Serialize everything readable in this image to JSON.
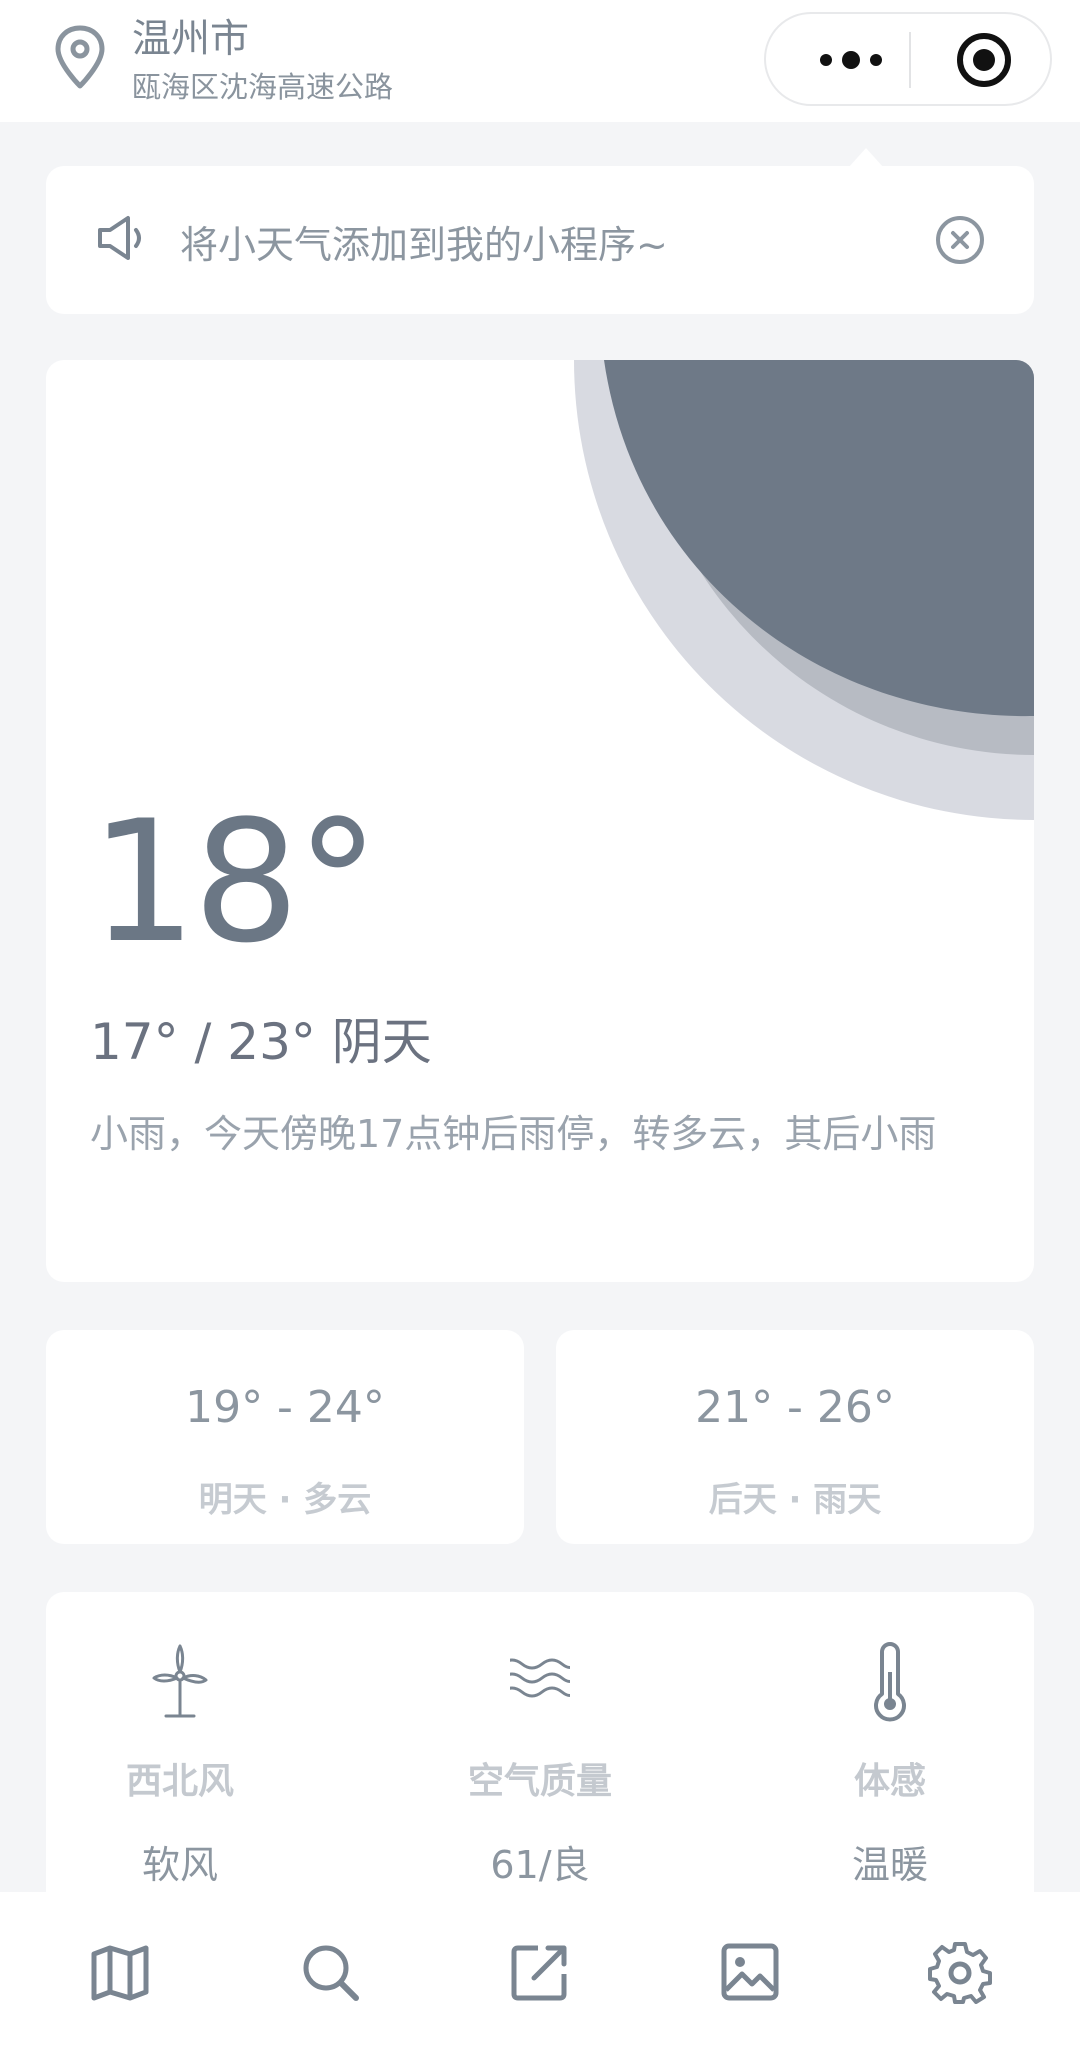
{
  "header": {
    "city": "温州市",
    "district": "瓯海区沈海高速公路",
    "location_icon": "location-pin-icon",
    "more_icon": "more-dots-icon",
    "close_mini_program_icon": "target-circle-icon"
  },
  "notice": {
    "text": "将小天气添加到我的小程序~",
    "speaker_icon": "speaker-icon",
    "close_icon": "close-circle-icon"
  },
  "current": {
    "temperature": "18°",
    "range_and_condition": "17° / 23° 阴天",
    "description": "小雨，今天傍晚17点钟后雨停，转多云，其后小雨"
  },
  "forecast": [
    {
      "temp_range": "19° - 24°",
      "day_condition": "明天 · 多云"
    },
    {
      "temp_range": "21° - 26°",
      "day_condition": "后天 · 雨天"
    }
  ],
  "stats": [
    {
      "icon": "windmill-icon",
      "label": "西北风",
      "value": "软风"
    },
    {
      "icon": "waves-icon",
      "label": "空气质量",
      "value": "61/良"
    },
    {
      "icon": "thermometer-icon",
      "label": "体感",
      "value": "温暖"
    }
  ],
  "tabbar": [
    {
      "icon": "map-icon"
    },
    {
      "icon": "search-icon"
    },
    {
      "icon": "share-icon"
    },
    {
      "icon": "image-icon"
    },
    {
      "icon": "gear-icon"
    }
  ],
  "colors": {
    "accent": "#6b7785",
    "background": "#f4f5f7",
    "circle_dark": "#6e7987",
    "circle_mid": "#b7bbc3",
    "circle_light": "#d8dae1"
  }
}
